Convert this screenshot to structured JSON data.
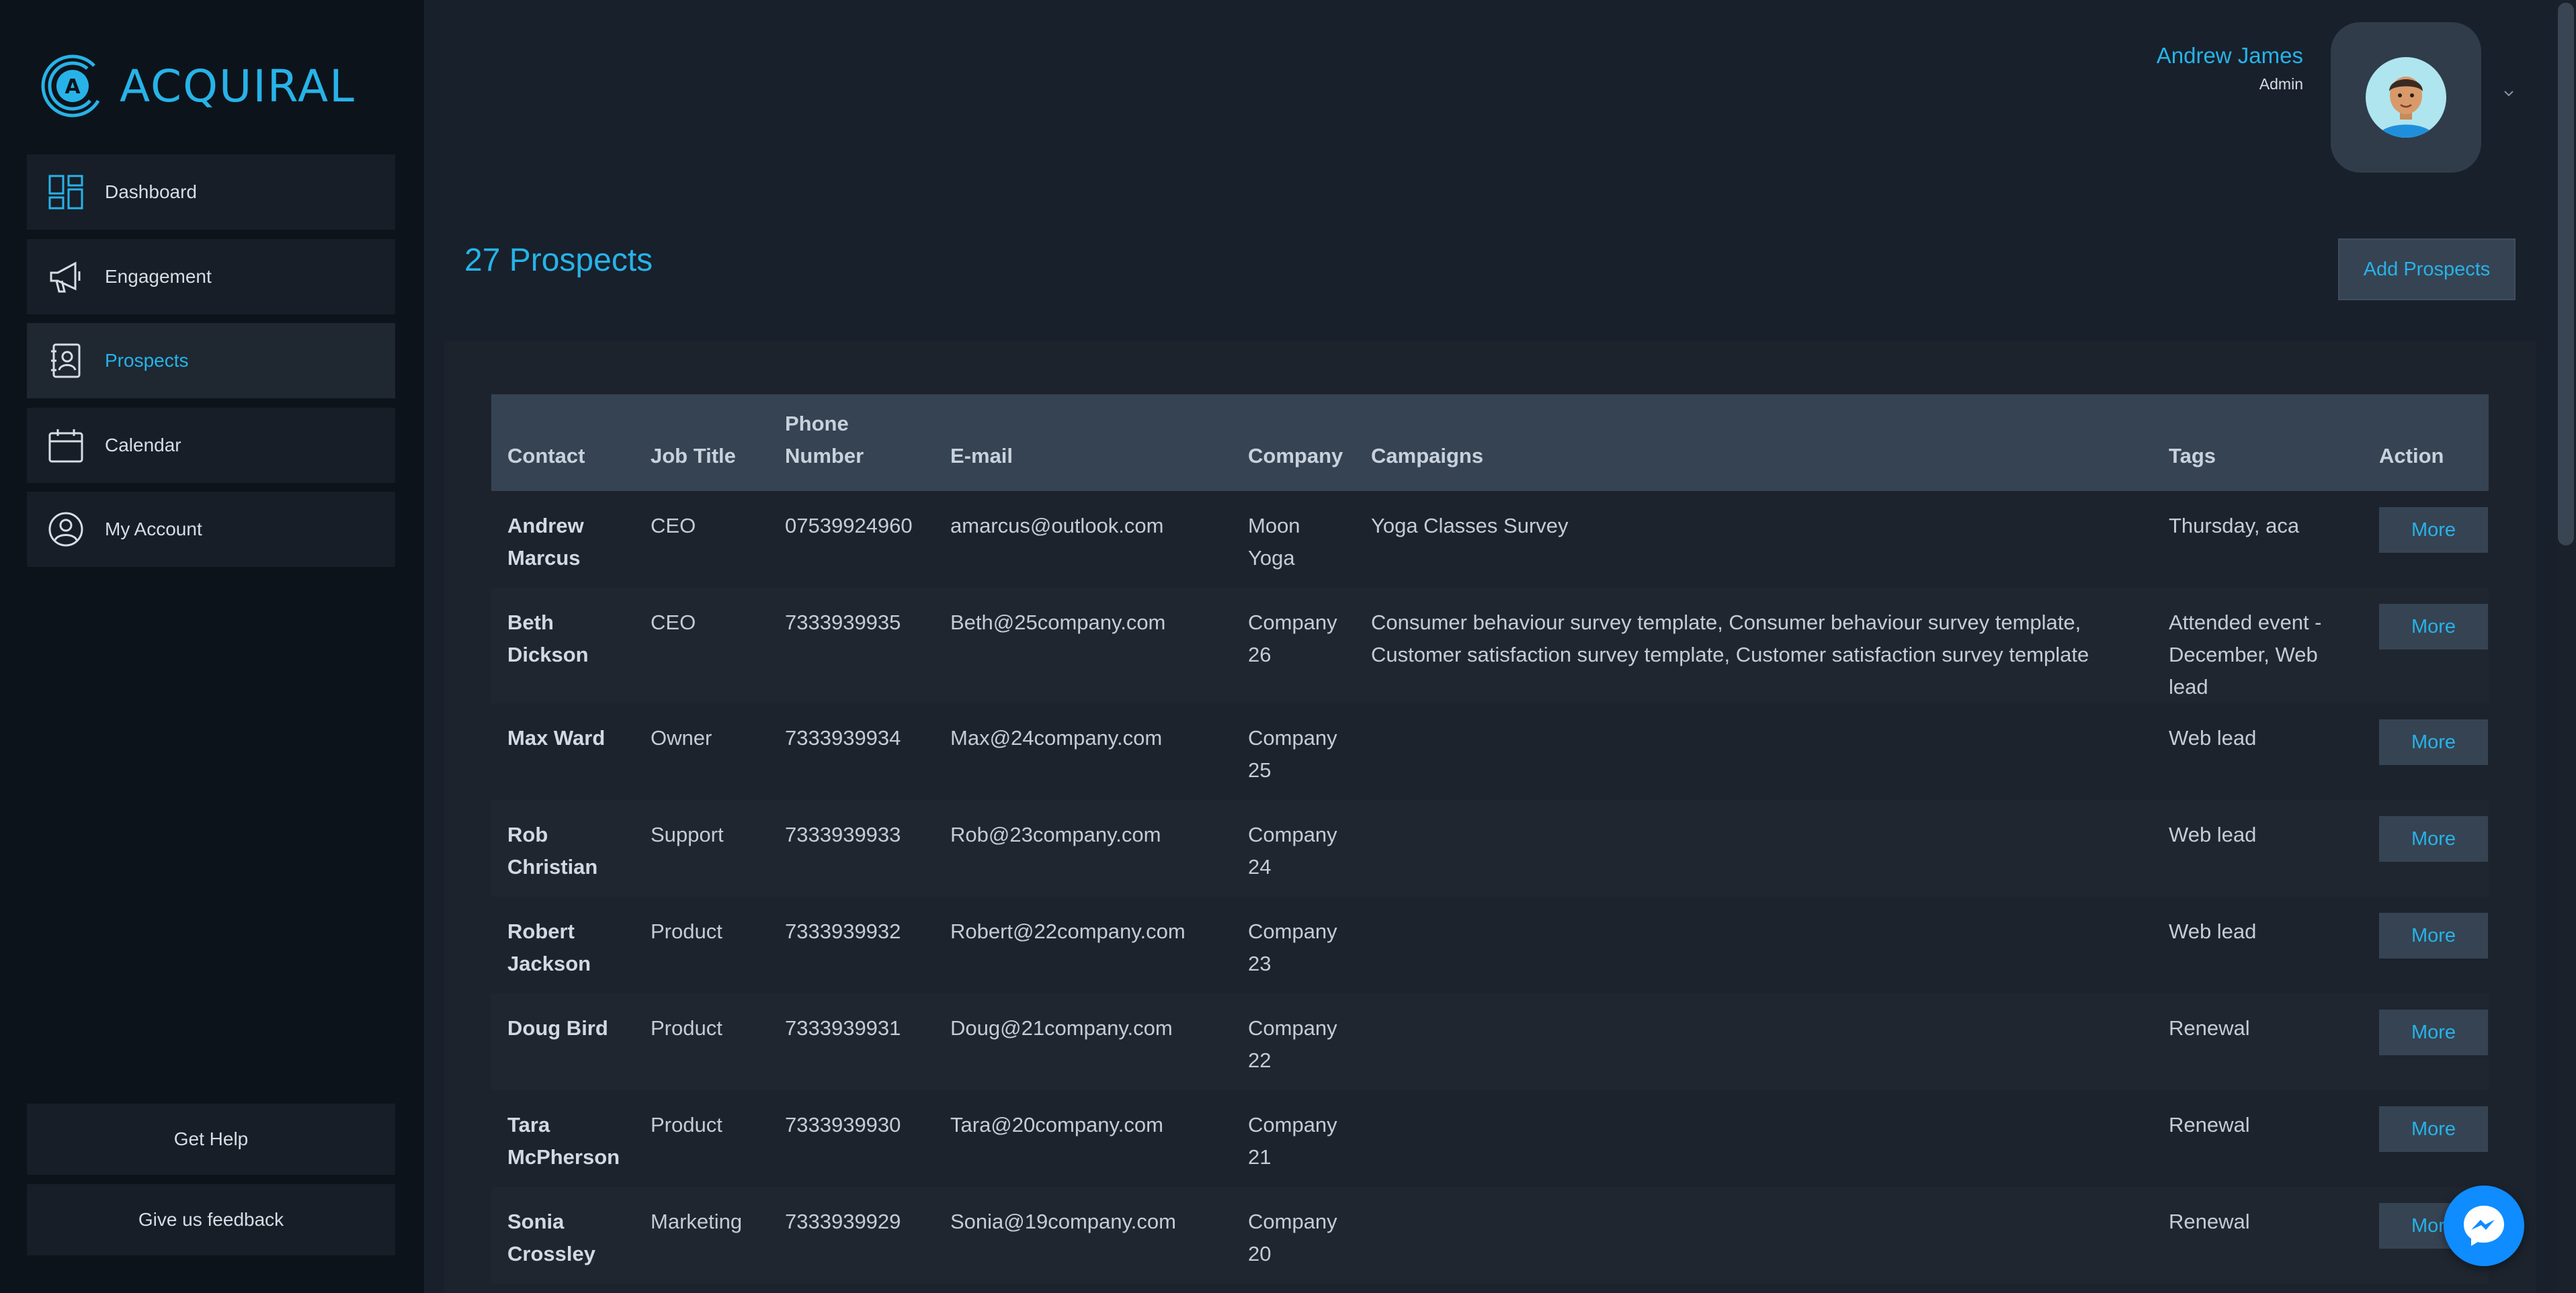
{
  "app": {
    "brand": "ACQUIRAL"
  },
  "sidebar": {
    "items": [
      {
        "label": "Dashboard",
        "icon": "dashboard-icon",
        "active": false
      },
      {
        "label": "Engagement",
        "icon": "megaphone-icon",
        "active": false
      },
      {
        "label": "Prospects",
        "icon": "contacts-book-icon",
        "active": true
      },
      {
        "label": "Calendar",
        "icon": "calendar-icon",
        "active": false
      },
      {
        "label": "My Account",
        "icon": "user-circle-icon",
        "active": false
      }
    ],
    "help_label": "Get Help",
    "feedback_label": "Give us feedback"
  },
  "header": {
    "user_name": "Andrew James",
    "user_role": "Admin",
    "avatar_icon": "avatar-icon",
    "menu_icon": "chevron-down-icon"
  },
  "page": {
    "title": "27 Prospects",
    "add_button_label": "Add Prospects"
  },
  "table": {
    "columns": [
      "Contact",
      "Job Title",
      "Phone Number",
      "E-mail",
      "Company",
      "Campaigns",
      "Tags",
      "Action"
    ],
    "rows": [
      {
        "contact": "Andrew Marcus",
        "job_title": "CEO",
        "phone": "07539924960",
        "email": "amarcus@outlook.com",
        "company": "Moon Yoga",
        "campaigns": "Yoga Classes Survey",
        "tags": "Thursday, aca",
        "action": "More"
      },
      {
        "contact": "Beth Dickson",
        "job_title": "CEO",
        "phone": "7333939935",
        "email": "Beth@25company.com",
        "company": "Company 26",
        "campaigns": "Consumer behaviour survey template, Consumer behaviour survey template, Customer satisfaction survey template, Customer satisfaction survey template",
        "tags": "Attended event - December, Web lead",
        "action": "More"
      },
      {
        "contact": "Max Ward",
        "job_title": "Owner",
        "phone": "7333939934",
        "email": "Max@24company.com",
        "company": "Company 25",
        "campaigns": "",
        "tags": "Web lead",
        "action": "More"
      },
      {
        "contact": "Rob Christian",
        "job_title": "Support",
        "phone": "7333939933",
        "email": "Rob@23company.com",
        "company": "Company 24",
        "campaigns": "",
        "tags": "Web lead",
        "action": "More"
      },
      {
        "contact": "Robert Jackson",
        "job_title": "Product",
        "phone": "7333939932",
        "email": "Robert@22company.com",
        "company": "Company 23",
        "campaigns": "",
        "tags": "Web lead",
        "action": "More"
      },
      {
        "contact": "Doug Bird",
        "job_title": "Product",
        "phone": "7333939931",
        "email": "Doug@21company.com",
        "company": "Company 22",
        "campaigns": "",
        "tags": "Renewal",
        "action": "More"
      },
      {
        "contact": "Tara McPherson",
        "job_title": "Product",
        "phone": "7333939930",
        "email": "Tara@20company.com",
        "company": "Company 21",
        "campaigns": "",
        "tags": "Renewal",
        "action": "More"
      },
      {
        "contact": "Sonia Crossley",
        "job_title": "Marketing",
        "phone": "7333939929",
        "email": "Sonia@19company.com",
        "company": "Company 20",
        "campaigns": "",
        "tags": "Renewal",
        "action": "More"
      }
    ]
  },
  "chat_widget": {
    "icon": "messenger-icon"
  },
  "colors": {
    "accent": "#27b3e8",
    "sidebar_bg": "#0d131b",
    "page_bg": "#18202b",
    "table_header_bg": "#364353"
  }
}
